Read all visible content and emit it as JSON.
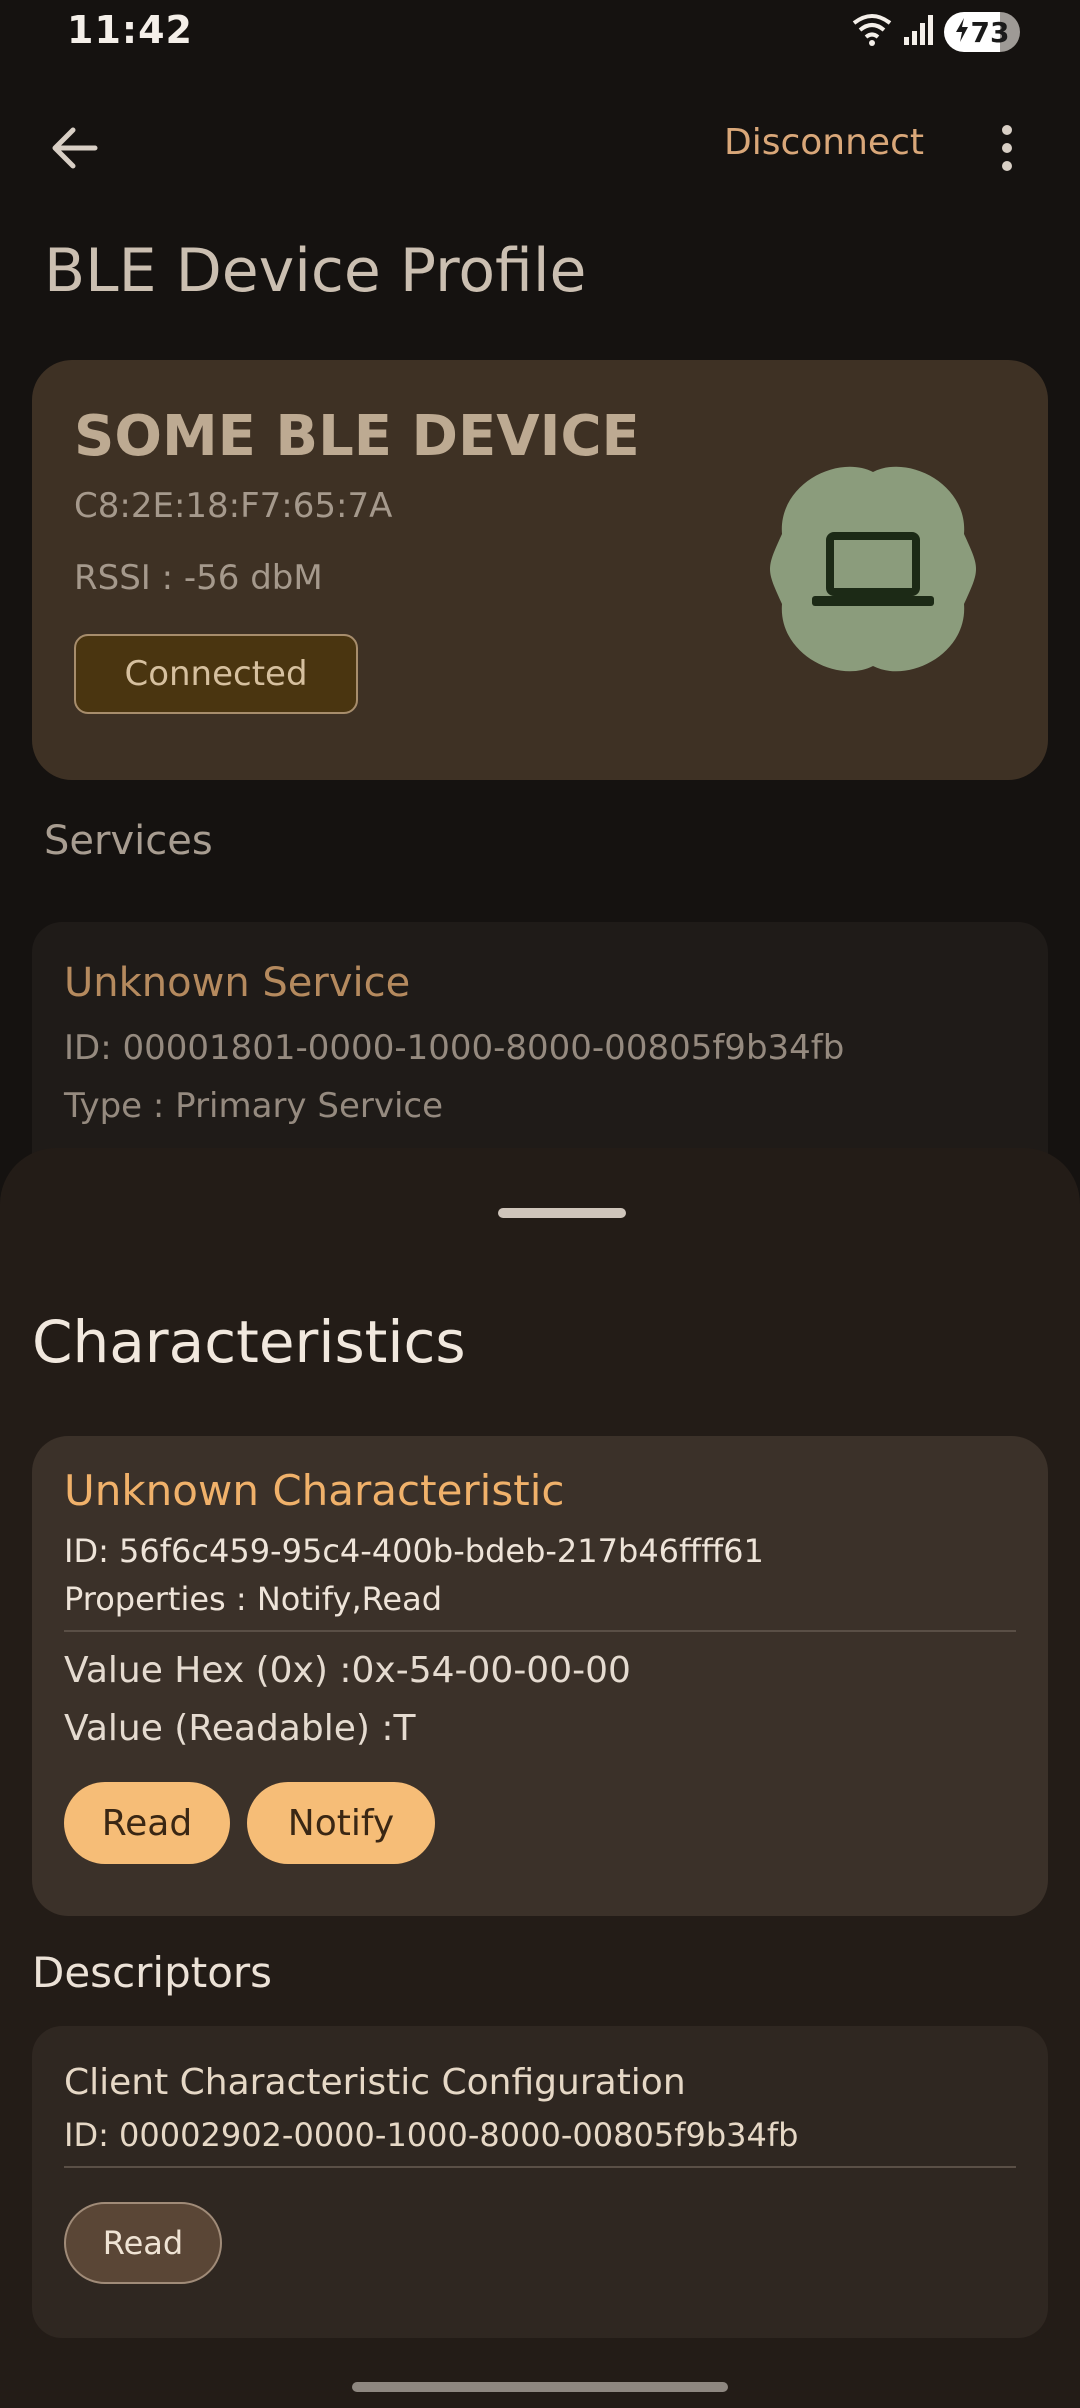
{
  "status_bar": {
    "time": "11:42",
    "battery": "73"
  },
  "top_bar": {
    "disconnect_label": "Disconnect"
  },
  "page_title": "BLE Device Profile",
  "device": {
    "name": "SOME BLE DEVICE",
    "mac": "C8:2E:18:F7:65:7A",
    "rssi": "RSSI : -56 dbM",
    "status": "Connected",
    "icon": "laptop-icon"
  },
  "services": {
    "label": "Services",
    "items": [
      {
        "name": "Unknown Service",
        "id": "ID: 00001801-0000-1000-8000-00805f9b34fb",
        "type": "Type : Primary Service"
      }
    ]
  },
  "sheet": {
    "title": "Characteristics",
    "characteristic": {
      "name": "Unknown Characteristic",
      "id": "ID: 56f6c459-95c4-400b-bdeb-217b46ffff61",
      "properties": "Properties : Notify,Read",
      "value_hex": "Value Hex (0x) :0x-54-00-00-00",
      "value_readable": "Value (Readable) :T",
      "read_label": "Read",
      "notify_label": "Notify"
    },
    "descriptors": {
      "label": "Descriptors",
      "items": [
        {
          "name": "Client Characteristic Configuration",
          "id": "ID: 00002902-0000-1000-8000-00805f9b34fb",
          "read_label": "Read"
        }
      ]
    }
  },
  "colors": {
    "accent": "#f6bd77",
    "card": "#3e3124",
    "background": "#151210",
    "sheet": "#231c17",
    "blob": "#8b9c7c"
  }
}
